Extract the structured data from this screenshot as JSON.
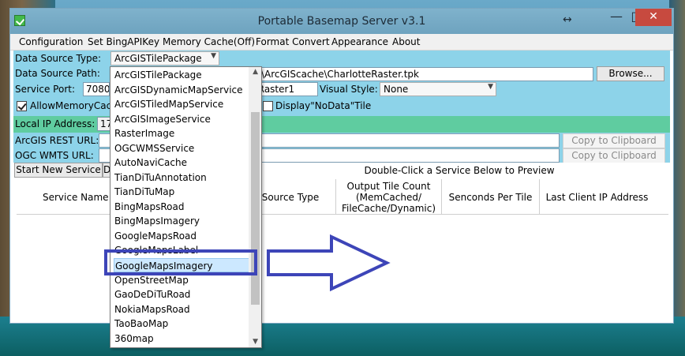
{
  "window": {
    "title": "Portable Basemap Server v3.1",
    "controls": {
      "minimize": "—",
      "maximize": "□",
      "close": "✕",
      "resize": "↔"
    }
  },
  "menu": [
    "Configuration",
    "Set BingAPIKey",
    "Memory Cache(Off)",
    "Format Convert",
    "Appearance",
    "About"
  ],
  "config": {
    "data_source_type_label": "Data Source Type:",
    "data_source_type_value": "ArcGISTilePackage",
    "data_source_path_label": "Data Source Path:",
    "data_source_path_value": "\\ArcGIScache\\CharlotteRaster.tpk",
    "browse_label": "Browse...",
    "service_port_label": "Service Port:",
    "service_port_value": "7080",
    "service_name_value": "CharlotteRaster1",
    "visual_style_label": "Visual Style:",
    "visual_style_value": "None",
    "allow_memory_cache_label": "AllowMemoryCache",
    "display_nodata_label": "Display\"NoData\"Tile"
  },
  "network": {
    "local_ip_label": "Local IP Address:",
    "local_ip_value": "17",
    "arcgis_rest_label": "ArcGIS REST URL:",
    "ogc_wmts_label": "OGC WMTS URL:",
    "copy_label": "Copy to Clipboard"
  },
  "services": {
    "start_new_service": "Start New Service",
    "preview_hint": "Double-Click a Service Below to Preview",
    "columns": [
      "Service Name",
      "Source Type",
      "Output Tile Count\n(MemCached/\nFileCache/Dynamic)",
      "Senconds Per Tile",
      "Last Client IP Address"
    ]
  },
  "dropdown": {
    "items": [
      "ArcGISTilePackage",
      "ArcGISDynamicMapService",
      "ArcGISTiledMapService",
      "ArcGISImageService",
      "RasterImage",
      "OGCWMSService",
      "AutoNaviCache",
      "TianDiTuAnnotation",
      "TianDiTuMap",
      "BingMapsRoad",
      "BingMapsImagery",
      "GoogleMapsRoad",
      "GoogleMapsLabel",
      "GoogleMapsImagery",
      "OpenStreetMap",
      "GaoDeDiTuRoad",
      "NokiaMapsRoad",
      "TaoBaoMap",
      "360map"
    ],
    "selected": "GoogleMapsImagery"
  },
  "colors": {
    "config_panel": "#8dd3e9",
    "ip_panel": "#5fcca0",
    "annotation": "#3d45b8",
    "close_button": "#c74a3f"
  }
}
